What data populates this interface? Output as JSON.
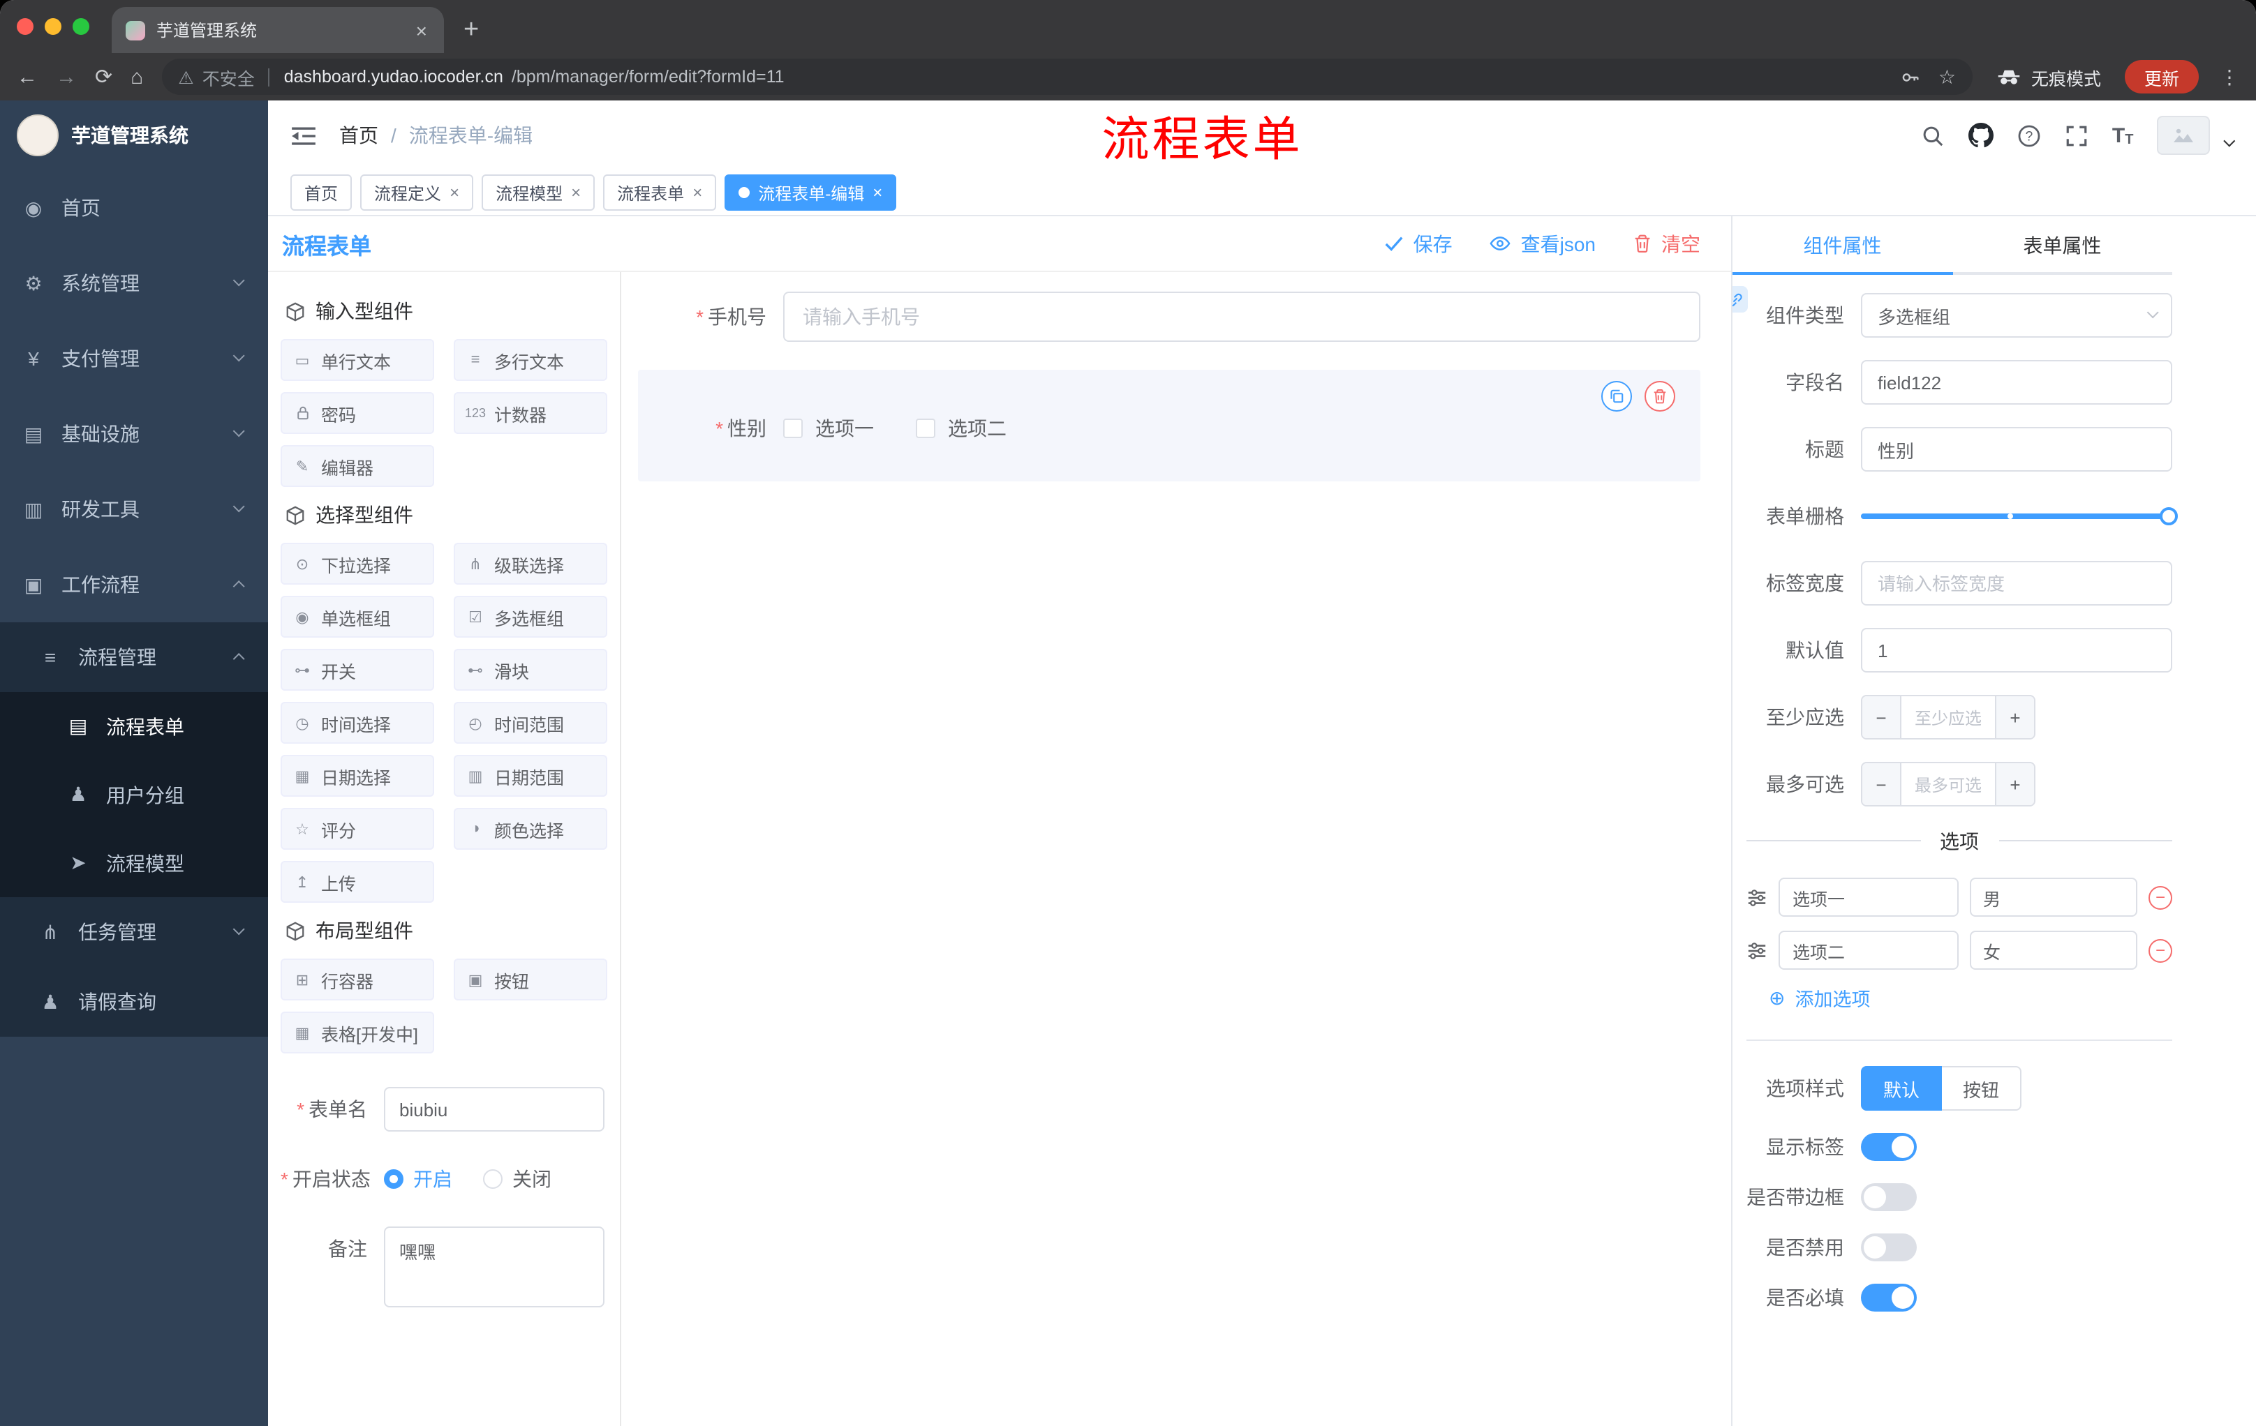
{
  "browser": {
    "tab_title": "芋道管理系统",
    "security_label": "不安全",
    "url_domain": "dashboard.yudao.iocoder.cn",
    "url_path": "/bpm/manager/form/edit?formId=11",
    "incognito_label": "无痕模式",
    "update_label": "更新"
  },
  "sidebar": {
    "app_title": "芋道管理系统",
    "menu": {
      "home": "首页",
      "system": "系统管理",
      "payment": "支付管理",
      "infra": "基础设施",
      "devtools": "研发工具",
      "workflow": "工作流程",
      "process_mgmt": "流程管理",
      "process_form": "流程表单",
      "user_group": "用户分组",
      "process_model": "流程模型",
      "task_mgmt": "任务管理",
      "leave_query": "请假查询"
    }
  },
  "header": {
    "breadcrumb_home": "首页",
    "breadcrumb_current": "流程表单-编辑",
    "annotation": "流程表单"
  },
  "tags": {
    "home": "首页",
    "process_def": "流程定义",
    "process_model": "流程模型",
    "process_form": "流程表单",
    "process_form_edit": "流程表单-编辑"
  },
  "designer": {
    "title": "流程表单",
    "save": "保存",
    "view_json": "查看json",
    "clear": "清空",
    "groups": {
      "input": "输入型组件",
      "select": "选择型组件",
      "layout": "布局型组件"
    },
    "components": {
      "single_text": "单行文本",
      "multi_text": "多行文本",
      "password": "密码",
      "counter": "计数器",
      "editor": "编辑器",
      "dropdown": "下拉选择",
      "cascader": "级联选择",
      "radio_group": "单选框组",
      "checkbox_group": "多选框组",
      "switch": "开关",
      "slider": "滑块",
      "time_picker": "时间选择",
      "time_range": "时间范围",
      "date_picker": "日期选择",
      "date_range": "日期范围",
      "rate": "评分",
      "color_picker": "颜色选择",
      "upload": "上传",
      "row_container": "行容器",
      "button": "按钮",
      "table_dev": "表格[开发中]"
    },
    "meta": {
      "form_name_label": "表单名",
      "form_name_value": "biubiu",
      "status_label": "开启状态",
      "status_on": "开启",
      "status_off": "关闭",
      "remark_label": "备注",
      "remark_value": "嘿嘿"
    },
    "canvas": {
      "phone_label": "手机号",
      "phone_placeholder": "请输入手机号",
      "gender_label": "性别",
      "gender_option1": "选项一",
      "gender_option2": "选项二"
    }
  },
  "props": {
    "tab_component": "组件属性",
    "tab_form": "表单属性",
    "component_type_label": "组件类型",
    "component_type_value": "多选框组",
    "field_name_label": "字段名",
    "field_name_value": "field122",
    "title_label": "标题",
    "title_value": "性别",
    "grid_label": "表单栅格",
    "label_width_label": "标签宽度",
    "label_width_placeholder": "请输入标签宽度",
    "default_label": "默认值",
    "default_value": "1",
    "min_select_label": "至少应选",
    "min_select_placeholder": "至少应选",
    "max_select_label": "最多可选",
    "max_select_placeholder": "最多可选",
    "options_divider": "选项",
    "option1_label": "选项一",
    "option1_value": "男",
    "option2_label": "选项二",
    "option2_value": "女",
    "add_option": "添加选项",
    "option_style_label": "选项样式",
    "style_default": "默认",
    "style_button": "按钮",
    "show_label_label": "显示标签",
    "border_label": "是否带边框",
    "disabled_label": "是否禁用",
    "required_label": "是否必填"
  },
  "colors": {
    "accent": "#409eff",
    "danger": "#f56c6c",
    "annotation_red": "#fe0100",
    "sidebar_bg": "#304156"
  },
  "glyphs": {
    "back": "←",
    "forward": "→",
    "reload": "⟳",
    "home": "⌂",
    "warning": "⚠",
    "star": "☆",
    "dots_vertical": "⋮",
    "plus": "+",
    "close": "×",
    "minus": "−",
    "asterisk": "*",
    "breadcrumb_sep": "/",
    "add_circle": "⊕",
    "font_large": "T",
    "font_small": "T",
    "menu_home": "◉",
    "menu_system": "⚙",
    "menu_payment": "¥",
    "menu_infra": "▤",
    "menu_dev": "▥",
    "menu_workflow": "▣",
    "menu_process": "≡",
    "menu_form": "▤",
    "menu_users": "♟",
    "menu_model": "➤",
    "menu_task": "⋔",
    "menu_person": "♟",
    "chip_single": "▭",
    "chip_multi": "≡",
    "chip_counter": "123",
    "chip_editor": "✎",
    "chip_dropdown": "⊙",
    "chip_cascade": "⋔",
    "chip_radio": "◉",
    "chip_checkbox": "☑",
    "chip_switch": "⊶",
    "chip_slider": "⊷",
    "chip_time": "◷",
    "chip_timerange": "◴",
    "chip_date": "▦",
    "chip_daterange": "▥",
    "chip_rate": "☆",
    "chip_color": "◑",
    "chip_upload": "↥",
    "chip_row": "⊞",
    "chip_button": "▣",
    "chip_table": "▦"
  }
}
